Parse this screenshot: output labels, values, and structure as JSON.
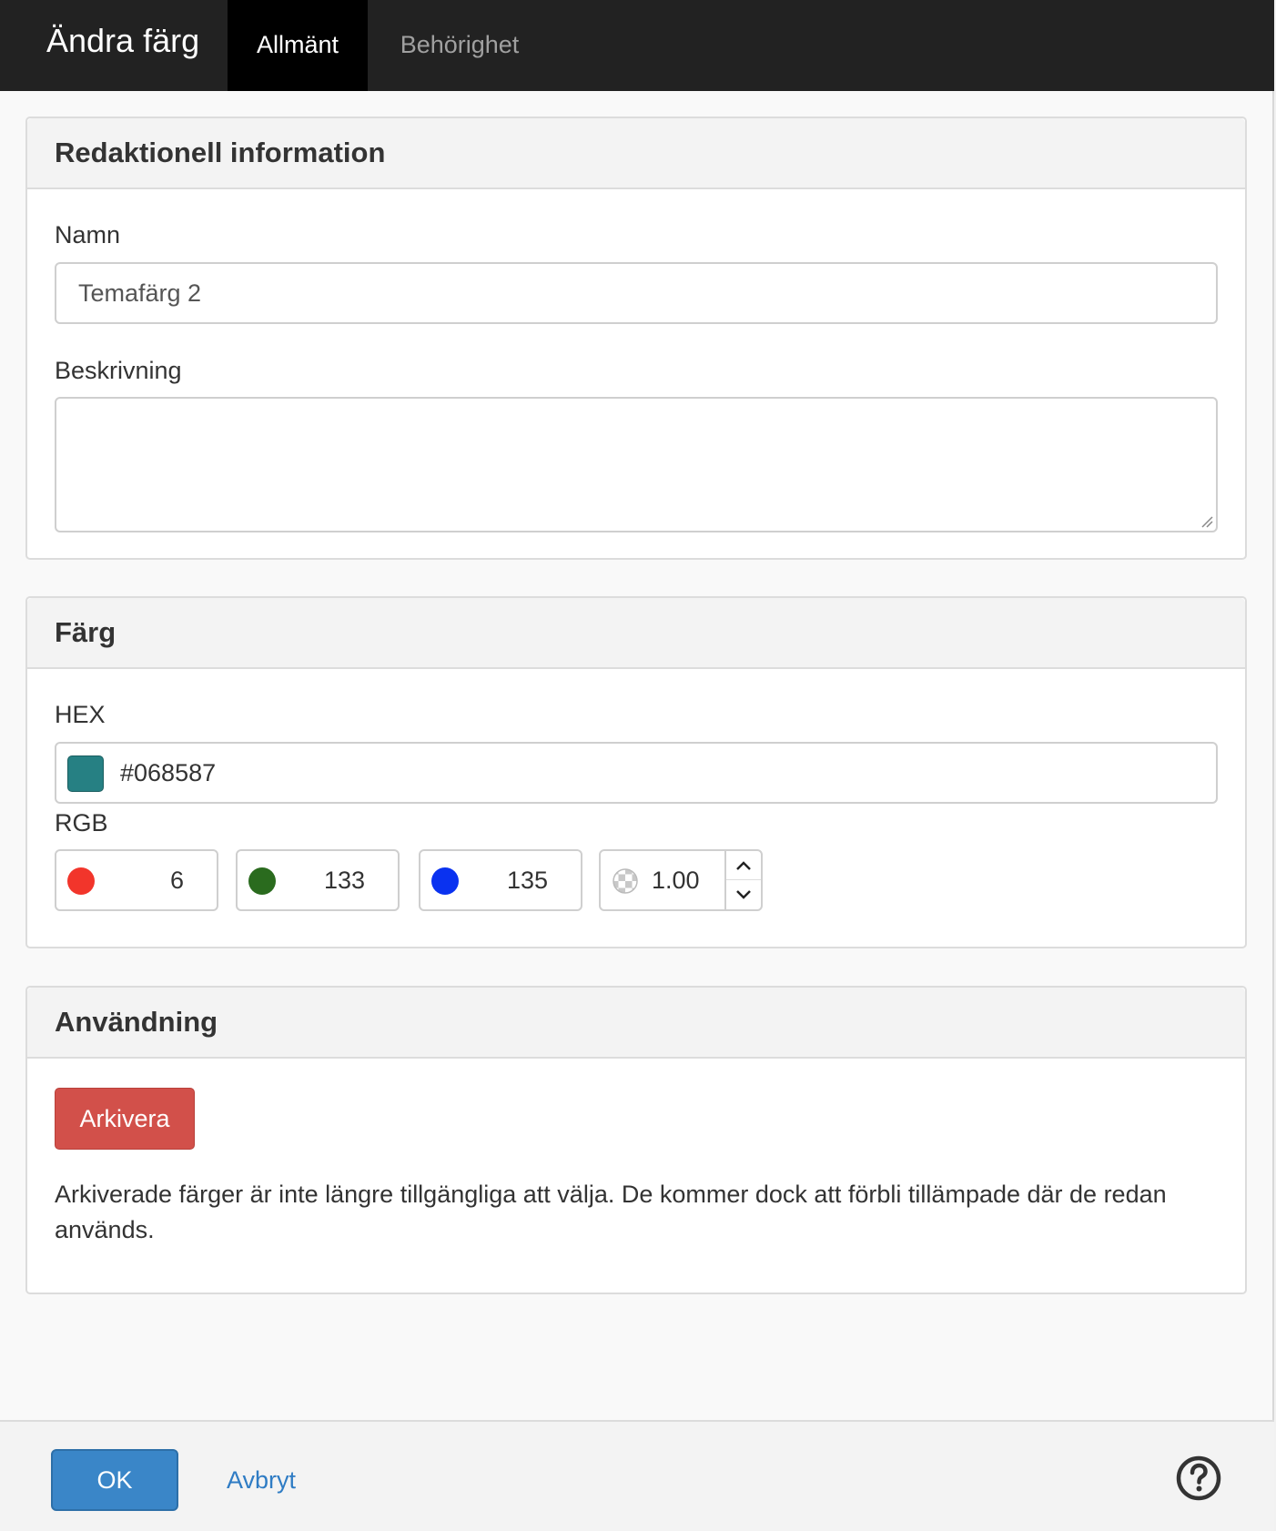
{
  "dialog": {
    "title": "Ändra färg",
    "tabs": [
      {
        "label": "Allmänt",
        "active": true
      },
      {
        "label": "Behörighet",
        "active": false
      }
    ]
  },
  "editorial": {
    "heading": "Redaktionell information",
    "name_label": "Namn",
    "name_value": "Temafärg 2",
    "description_label": "Beskrivning",
    "description_value": ""
  },
  "color": {
    "heading": "Färg",
    "hex_label": "HEX",
    "hex_value": "#068587",
    "swatch_color": "#268083",
    "rgb_label": "RGB",
    "red": "6",
    "green": "133",
    "blue": "135",
    "alpha": "1.00",
    "red_dot_color": "#f2352b",
    "green_dot_color": "#2a6b1e",
    "blue_dot_color": "#0a32f0"
  },
  "usage": {
    "heading": "Användning",
    "archive_label": "Arkivera",
    "archive_text": "Arkiverade färger är inte längre tillgängliga att välja. De kommer dock att förbli tillämpade där de redan används."
  },
  "footer": {
    "ok_label": "OK",
    "cancel_label": "Avbryt"
  }
}
